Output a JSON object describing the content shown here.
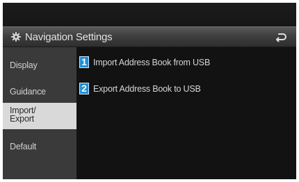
{
  "header": {
    "title": "Navigation Settings",
    "left_icon": "gear-icon",
    "back_icon": "back-arrow-icon"
  },
  "sidebar": {
    "items": [
      {
        "label": "Display",
        "active": false
      },
      {
        "label": "Guidance",
        "active": false
      },
      {
        "label": "Import/\nExport",
        "active": true
      },
      {
        "label": "Default",
        "active": false
      }
    ]
  },
  "main": {
    "items": [
      {
        "number": "1",
        "label": "Import Address Book from USB"
      },
      {
        "number": "2",
        "label": "Export Address Book to USB"
      }
    ]
  },
  "colors": {
    "badge": "#1f8fd6",
    "active_tab": "#d9d9d9",
    "sidebar_bg": "#3a3a3a"
  }
}
